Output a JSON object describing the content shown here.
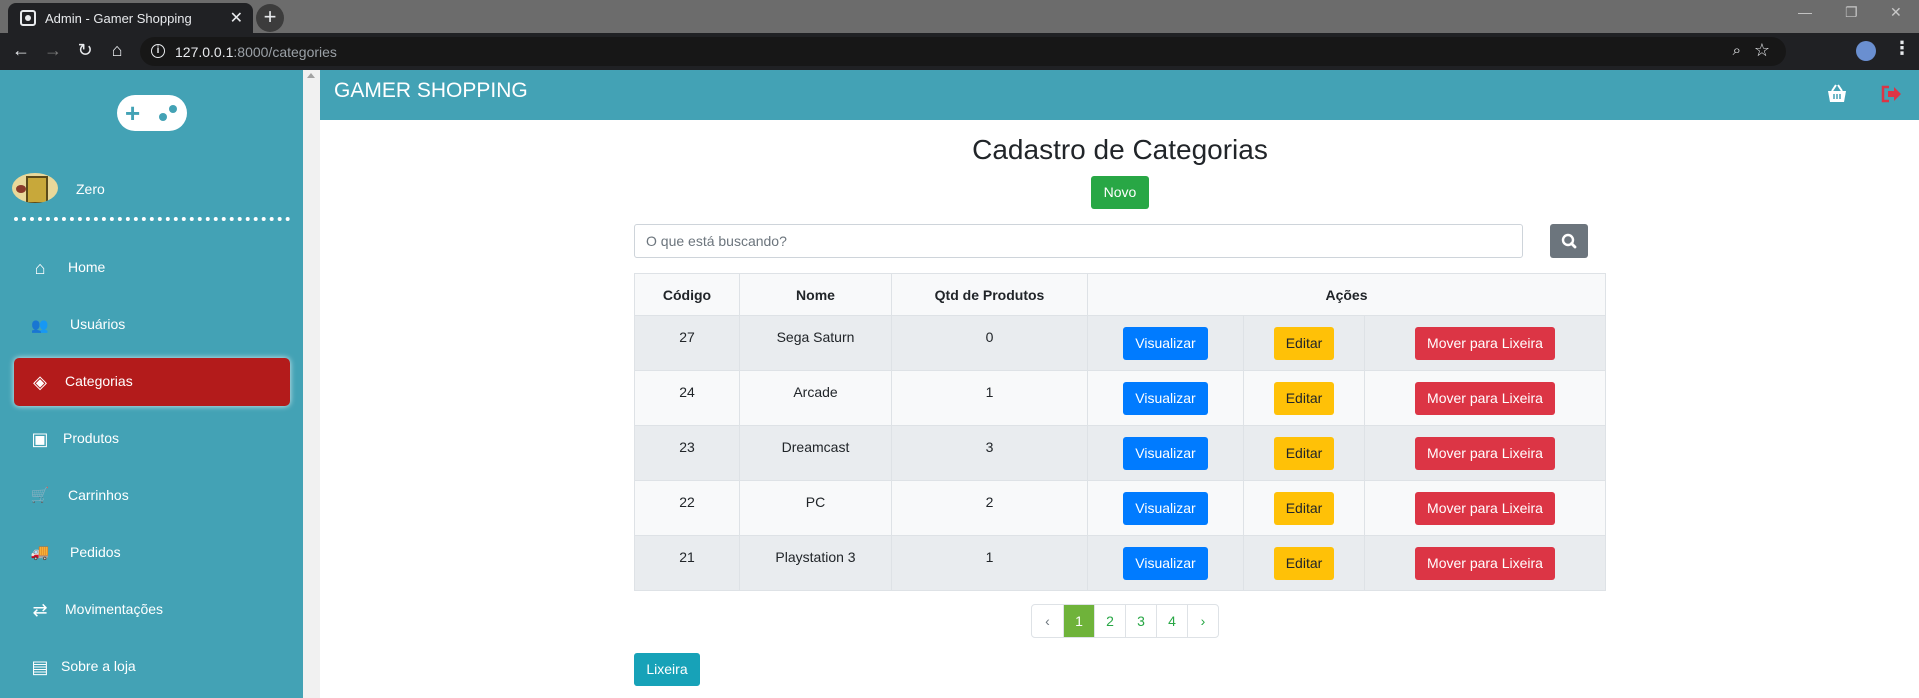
{
  "browser": {
    "tab_title": "Admin - Gamer Shopping",
    "tab_close": "✕",
    "new_tab": "+",
    "url_host": "127.0.0.1",
    "url_rest": ":8000/categories"
  },
  "sidebar": {
    "user_name": "Zero",
    "items": [
      {
        "label": "Home",
        "icon": "home-icon",
        "glyph": "⌂"
      },
      {
        "label": "Usuários",
        "icon": "users-icon",
        "glyph": "👥"
      },
      {
        "label": "Categorias",
        "icon": "cubes-icon",
        "glyph": "◈"
      },
      {
        "label": "Produtos",
        "icon": "shopping-bag-icon",
        "glyph": "▣"
      },
      {
        "label": "Carrinhos",
        "icon": "cart-icon",
        "glyph": "🛒"
      },
      {
        "label": "Pedidos",
        "icon": "truck-icon",
        "glyph": "🚚"
      },
      {
        "label": "Movimentações",
        "icon": "exchange-icon",
        "glyph": "⇄"
      },
      {
        "label": "Sobre a loja",
        "icon": "file-icon",
        "glyph": "▤"
      }
    ],
    "active_index": 2
  },
  "topbar": {
    "brand": "GAMER SHOPPING"
  },
  "main": {
    "title": "Cadastro de Categorias",
    "new_button": "Novo",
    "search_placeholder": "O que está buscando?",
    "table": {
      "headers": [
        "Código",
        "Nome",
        "Qtd de Produtos",
        "Ações"
      ],
      "rows": [
        {
          "code": "27",
          "name": "Sega Saturn",
          "qty": "0"
        },
        {
          "code": "24",
          "name": "Arcade",
          "qty": "1"
        },
        {
          "code": "23",
          "name": "Dreamcast",
          "qty": "3"
        },
        {
          "code": "22",
          "name": "PC",
          "qty": "2"
        },
        {
          "code": "21",
          "name": "Playstation 3",
          "qty": "1"
        }
      ],
      "actions": {
        "view": "Visualizar",
        "edit": "Editar",
        "trash": "Mover para Lixeira"
      }
    },
    "pagination": {
      "prev": "‹",
      "pages": [
        "1",
        "2",
        "3",
        "4"
      ],
      "next": "›",
      "current": "1"
    },
    "trash_button": "Lixeira"
  },
  "colors": {
    "sidebar": "#43a2b5",
    "active": "#b31b1b",
    "primary": "#007bff",
    "warning": "#ffc107",
    "danger": "#dc3545",
    "success": "#28a745"
  }
}
